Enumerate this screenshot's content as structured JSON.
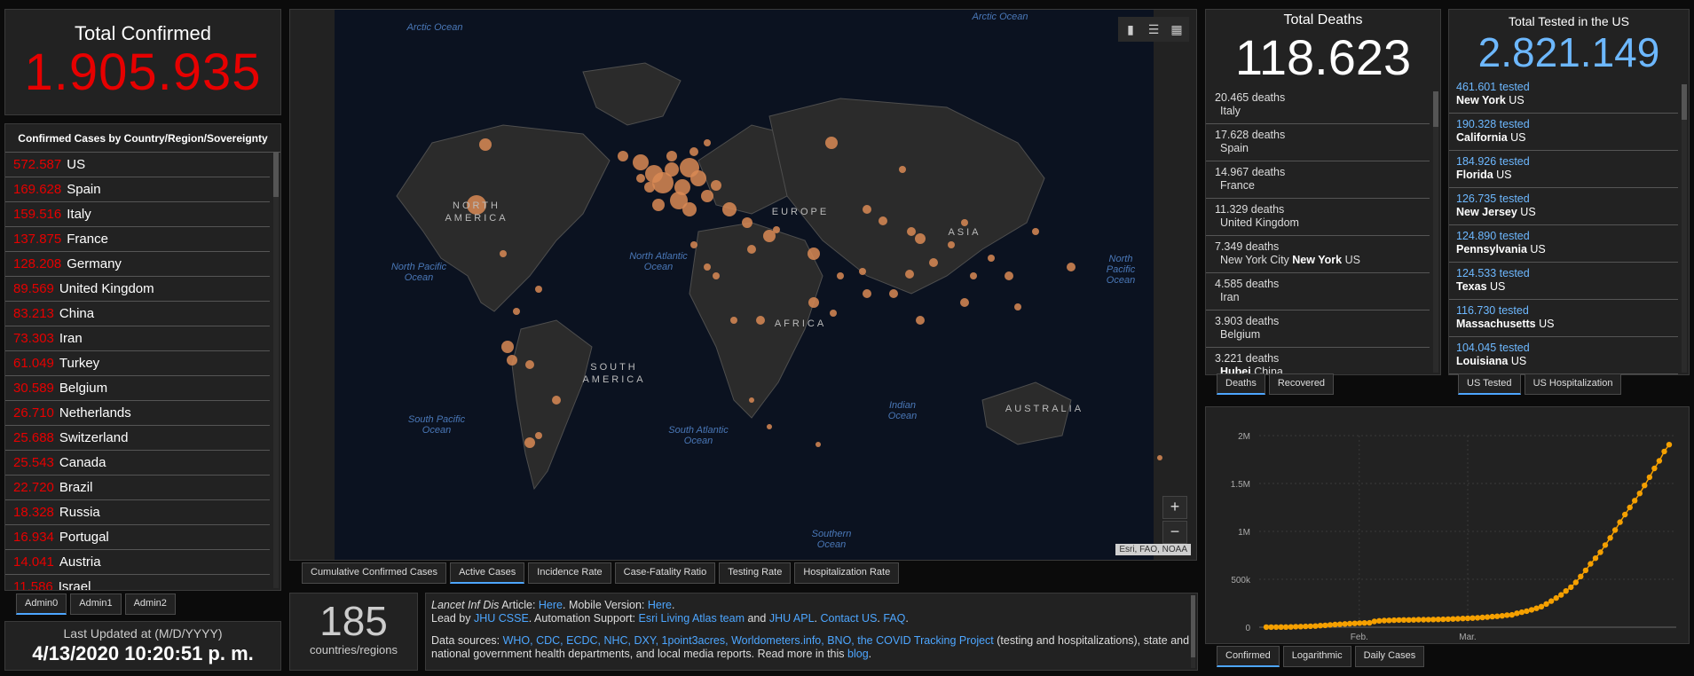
{
  "total_confirmed": {
    "label": "Total Confirmed",
    "value": "1.905.935"
  },
  "country_list": {
    "header": "Confirmed Cases by Country/Region/Sovereignty",
    "items": [
      {
        "value": "572.587",
        "name": "US"
      },
      {
        "value": "169.628",
        "name": "Spain"
      },
      {
        "value": "159.516",
        "name": "Italy"
      },
      {
        "value": "137.875",
        "name": "France"
      },
      {
        "value": "128.208",
        "name": "Germany"
      },
      {
        "value": "89.569",
        "name": "United Kingdom"
      },
      {
        "value": "83.213",
        "name": "China"
      },
      {
        "value": "73.303",
        "name": "Iran"
      },
      {
        "value": "61.049",
        "name": "Turkey"
      },
      {
        "value": "30.589",
        "name": "Belgium"
      },
      {
        "value": "26.710",
        "name": "Netherlands"
      },
      {
        "value": "25.688",
        "name": "Switzerland"
      },
      {
        "value": "25.543",
        "name": "Canada"
      },
      {
        "value": "22.720",
        "name": "Brazil"
      },
      {
        "value": "18.328",
        "name": "Russia"
      },
      {
        "value": "16.934",
        "name": "Portugal"
      },
      {
        "value": "14.041",
        "name": "Austria"
      },
      {
        "value": "11.586",
        "name": "Israel"
      }
    ]
  },
  "admin_tabs": [
    "Admin0",
    "Admin1",
    "Admin2"
  ],
  "last_updated": {
    "label": "Last Updated at (M/D/YYYY)",
    "value": "4/13/2020 10:20:51 p. m."
  },
  "map": {
    "oceans": [
      "Arctic Ocean",
      "Arctic Ocean",
      "North Pacific Ocean",
      "North Atlantic Ocean",
      "North Pacific Ocean",
      "South Pacific Ocean",
      "South Atlantic Ocean",
      "Indian Ocean",
      "Southern Ocean"
    ],
    "continents": [
      "NORTH AMERICA",
      "EUROPE",
      "ASIA",
      "AFRICA",
      "SOUTH AMERICA",
      "AUSTRALIA"
    ],
    "attribution": "Esri, FAO, NOAA",
    "tools": [
      "bookmark-icon",
      "list-icon",
      "qr-icon"
    ],
    "zoom_in": "+",
    "zoom_out": "−"
  },
  "map_tabs": [
    "Cumulative Confirmed Cases",
    "Active Cases",
    "Incidence Rate",
    "Case-Fatality Ratio",
    "Testing Rate",
    "Hospitalization Rate"
  ],
  "countries_count": {
    "value": "185",
    "label": "countries/regions"
  },
  "info": {
    "line1_a": "Lancet Inf Dis",
    "line1_b": " Article: ",
    "line1_link1": "Here",
    "line1_c": ". Mobile Version: ",
    "line1_link2": "Here",
    "line1_d": ".",
    "line2_a": "Lead by ",
    "line2_link1": "JHU CSSE",
    "line2_b": ". Automation Support: ",
    "line2_link2": "Esri Living Atlas team",
    "line2_c": " and ",
    "line2_link3": "JHU APL",
    "line2_d": ". ",
    "line2_link4": "Contact US",
    "line2_e": ". ",
    "line2_link5": "FAQ",
    "line2_f": ".",
    "line3_a": "Data sources: ",
    "line3_links": "WHO, CDC, ECDC, NHC, DXY, 1point3acres, Worldometers.info, BNO, the COVID Tracking Project",
    "line3_b": " (testing and hospitalizations), state and national government health departments, and local media reports.  Read more in this ",
    "line3_link": "blog",
    "line3_c": "."
  },
  "deaths": {
    "label": "Total Deaths",
    "value": "118.623",
    "items": [
      {
        "value": "20.465 deaths",
        "place": "Italy",
        "bold": "",
        "suffix": ""
      },
      {
        "value": "17.628 deaths",
        "place": "Spain",
        "bold": "",
        "suffix": ""
      },
      {
        "value": "14.967 deaths",
        "place": "France",
        "bold": "",
        "suffix": ""
      },
      {
        "value": "11.329 deaths",
        "place": "United Kingdom",
        "bold": "",
        "suffix": ""
      },
      {
        "value": "7.349 deaths",
        "place": "New York City ",
        "bold": "New York",
        "suffix": " US"
      },
      {
        "value": "4.585 deaths",
        "place": "Iran",
        "bold": "",
        "suffix": ""
      },
      {
        "value": "3.903 deaths",
        "place": "Belgium",
        "bold": "",
        "suffix": ""
      },
      {
        "value": "3.221 deaths",
        "place": "",
        "bold": "Hubei",
        "suffix": " China"
      }
    ],
    "tabs": [
      "Deaths",
      "Recovered"
    ]
  },
  "tested": {
    "label": "Total Tested in the US",
    "value": "2.821.149",
    "items": [
      {
        "value": "461.601 tested",
        "state": "New York",
        "suffix": " US"
      },
      {
        "value": "190.328 tested",
        "state": "California",
        "suffix": " US"
      },
      {
        "value": "184.926 tested",
        "state": "Florida",
        "suffix": " US"
      },
      {
        "value": "126.735 tested",
        "state": "New Jersey",
        "suffix": " US"
      },
      {
        "value": "124.890 tested",
        "state": "Pennsylvania",
        "suffix": " US"
      },
      {
        "value": "124.533 tested",
        "state": "Texas",
        "suffix": " US"
      },
      {
        "value": "116.730 tested",
        "state": "Massachusetts",
        "suffix": " US"
      },
      {
        "value": "104.045 tested",
        "state": "Louisiana",
        "suffix": " US"
      }
    ],
    "tabs": [
      "US Tested",
      "US Hospitalization"
    ]
  },
  "chart_tabs": [
    "Confirmed",
    "Logarithmic",
    "Daily Cases"
  ],
  "chart_data": {
    "type": "line",
    "title": "",
    "xlabel": "",
    "ylabel": "",
    "x_tick_labels": [
      "Feb.",
      "Mar."
    ],
    "y_tick_labels": [
      "0",
      "500k",
      "1M",
      "1.5M",
      "2M"
    ],
    "ylim": [
      0,
      2000000
    ],
    "color": "#f5a000",
    "grid": true,
    "values": [
      555,
      654,
      941,
      1434,
      2118,
      2927,
      5578,
      6166,
      8234,
      9927,
      12038,
      16787,
      19881,
      23892,
      27636,
      30818,
      34392,
      37121,
      40151,
      42763,
      44802,
      45221,
      60368,
      66885,
      69030,
      71224,
      73258,
      75136,
      75639,
      76197,
      76819,
      78572,
      78958,
      79561,
      80406,
      81388,
      82746,
      84112,
      86011,
      88369,
      90306,
      92840,
      95120,
      97886,
      101801,
      105847,
      109821,
      113590,
      118620,
      125875,
      128352,
      145205,
      156101,
      167454,
      181574,
      197102,
      214821,
      242570,
      272208,
      304507,
      336953,
      378235,
      418045,
      467653,
      529591,
      593291,
      660693,
      720140,
      782389,
      857487,
      932605,
      1013466,
      1095917,
      1176060,
      1249754,
      1321481,
      1396476,
      1479804,
      1565278,
      1657526,
      1735650,
      1834721,
      1905935
    ]
  }
}
